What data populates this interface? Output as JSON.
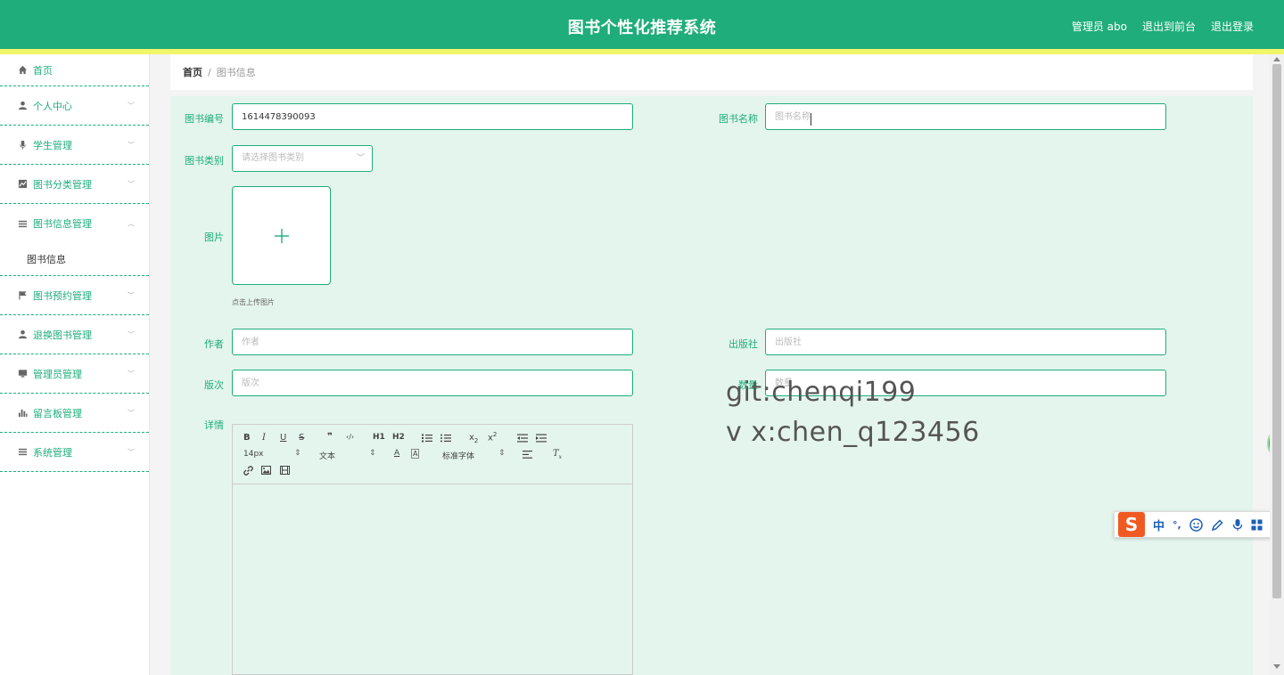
{
  "header": {
    "title": "图书个性化推荐系统",
    "user_label": "管理员 abo",
    "front_link": "退出到前台",
    "logout_link": "退出登录",
    "colors": {
      "primary": "#1ead7b",
      "stripe": "#f1f56a"
    }
  },
  "sidebar": {
    "items": [
      {
        "label": "首页",
        "icon": "home-icon"
      },
      {
        "label": "个人中心",
        "icon": "user-icon"
      },
      {
        "label": "学生管理",
        "icon": "microphone-icon"
      },
      {
        "label": "图书分类管理",
        "icon": "chart-icon"
      },
      {
        "label": "图书信息管理",
        "icon": "list-icon",
        "expanded": true
      },
      {
        "label": "图书预约管理",
        "icon": "flag-icon"
      },
      {
        "label": "退换图书管理",
        "icon": "user-icon"
      },
      {
        "label": "管理员管理",
        "icon": "monitor-icon"
      },
      {
        "label": "留言板管理",
        "icon": "bar-chart-icon"
      },
      {
        "label": "系统管理",
        "icon": "list-icon"
      }
    ],
    "submenu_label": "图书信息"
  },
  "breadcrumb": {
    "home": "首页",
    "separator": "/",
    "current": "图书信息"
  },
  "form": {
    "book_no_label": "图书编号",
    "book_no_value": "1614478390093",
    "book_name_label": "图书名称",
    "book_name_placeholder": "图书名称",
    "category_label": "图书类别",
    "category_placeholder": "请选择图书类别",
    "image_label": "图片",
    "upload_hint": "点击上传图片",
    "author_label": "作者",
    "author_placeholder": "作者",
    "publisher_label": "出版社",
    "publisher_placeholder": "出版社",
    "edition_label": "版次",
    "edition_placeholder": "版次",
    "quantity_label": "数量",
    "quantity_placeholder": "数量",
    "detail_label": "详情"
  },
  "editor": {
    "font_size": "14px",
    "text_style": "文本",
    "font_family": "标准字体",
    "buttons": [
      "B",
      "I",
      "U",
      "S",
      "❞",
      "‹/›",
      "H1",
      "H2"
    ]
  },
  "watermark": {
    "line1": "git:chenqi199",
    "line2": "v x:chen_q123456"
  },
  "ime": {
    "mode": "中",
    "punct": "°,"
  },
  "float_ball": "46"
}
